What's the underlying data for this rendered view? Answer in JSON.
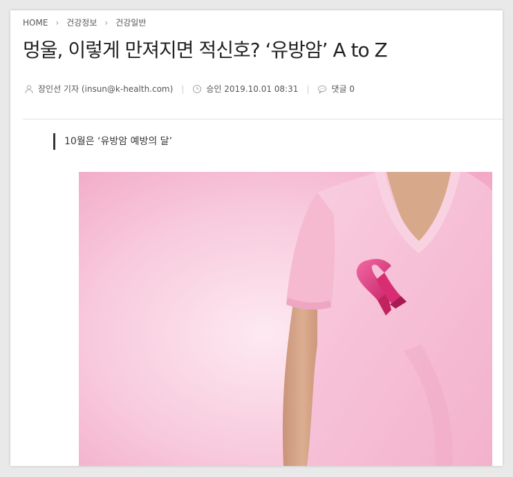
{
  "breadcrumb": {
    "items": [
      "HOME",
      "건강정보",
      "건강일반"
    ]
  },
  "article": {
    "title": "멍울, 이렇게 만져지면 적신호? ‘유방암’ A to Z",
    "author": "장인선 기자 (insun@k-health.com)",
    "approved": "승인 2019.10.01 08:31",
    "comments": "댓글 0",
    "subtitle": "10월은 ‘유방암 예방의 달’"
  },
  "colors": {
    "pink_bg": "#f4b6cf",
    "shirt": "#f7c3d7",
    "ribbon": "#e0367f",
    "skin": "#d9a98a"
  },
  "icons": {
    "author": "person-icon",
    "time": "clock-icon",
    "comments": "speech-bubble-icon",
    "separator": "chevron-right-icon"
  }
}
